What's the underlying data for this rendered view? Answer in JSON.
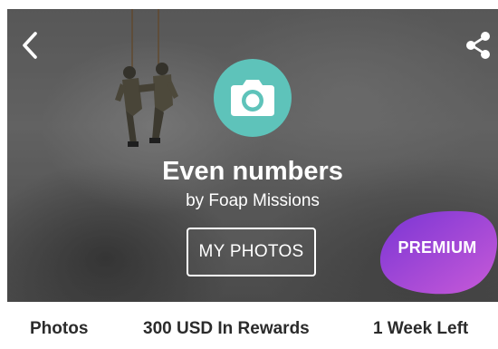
{
  "mission": {
    "title": "Even numbers",
    "byline": "by Foap Missions",
    "my_photos_label": "MY PHOTOS",
    "premium_label": "PREMIUM"
  },
  "stats": {
    "photos": "Photos",
    "rewards": "300 USD In Rewards",
    "time_left": "1 Week Left"
  },
  "icons": {
    "back": "chevron-left-icon",
    "share": "share-icon",
    "mission": "camera-icon"
  },
  "colors": {
    "accent_teal": "#5ec3ba",
    "premium_purple": "#8a3fd8",
    "premium_pink": "#c45ad6"
  }
}
